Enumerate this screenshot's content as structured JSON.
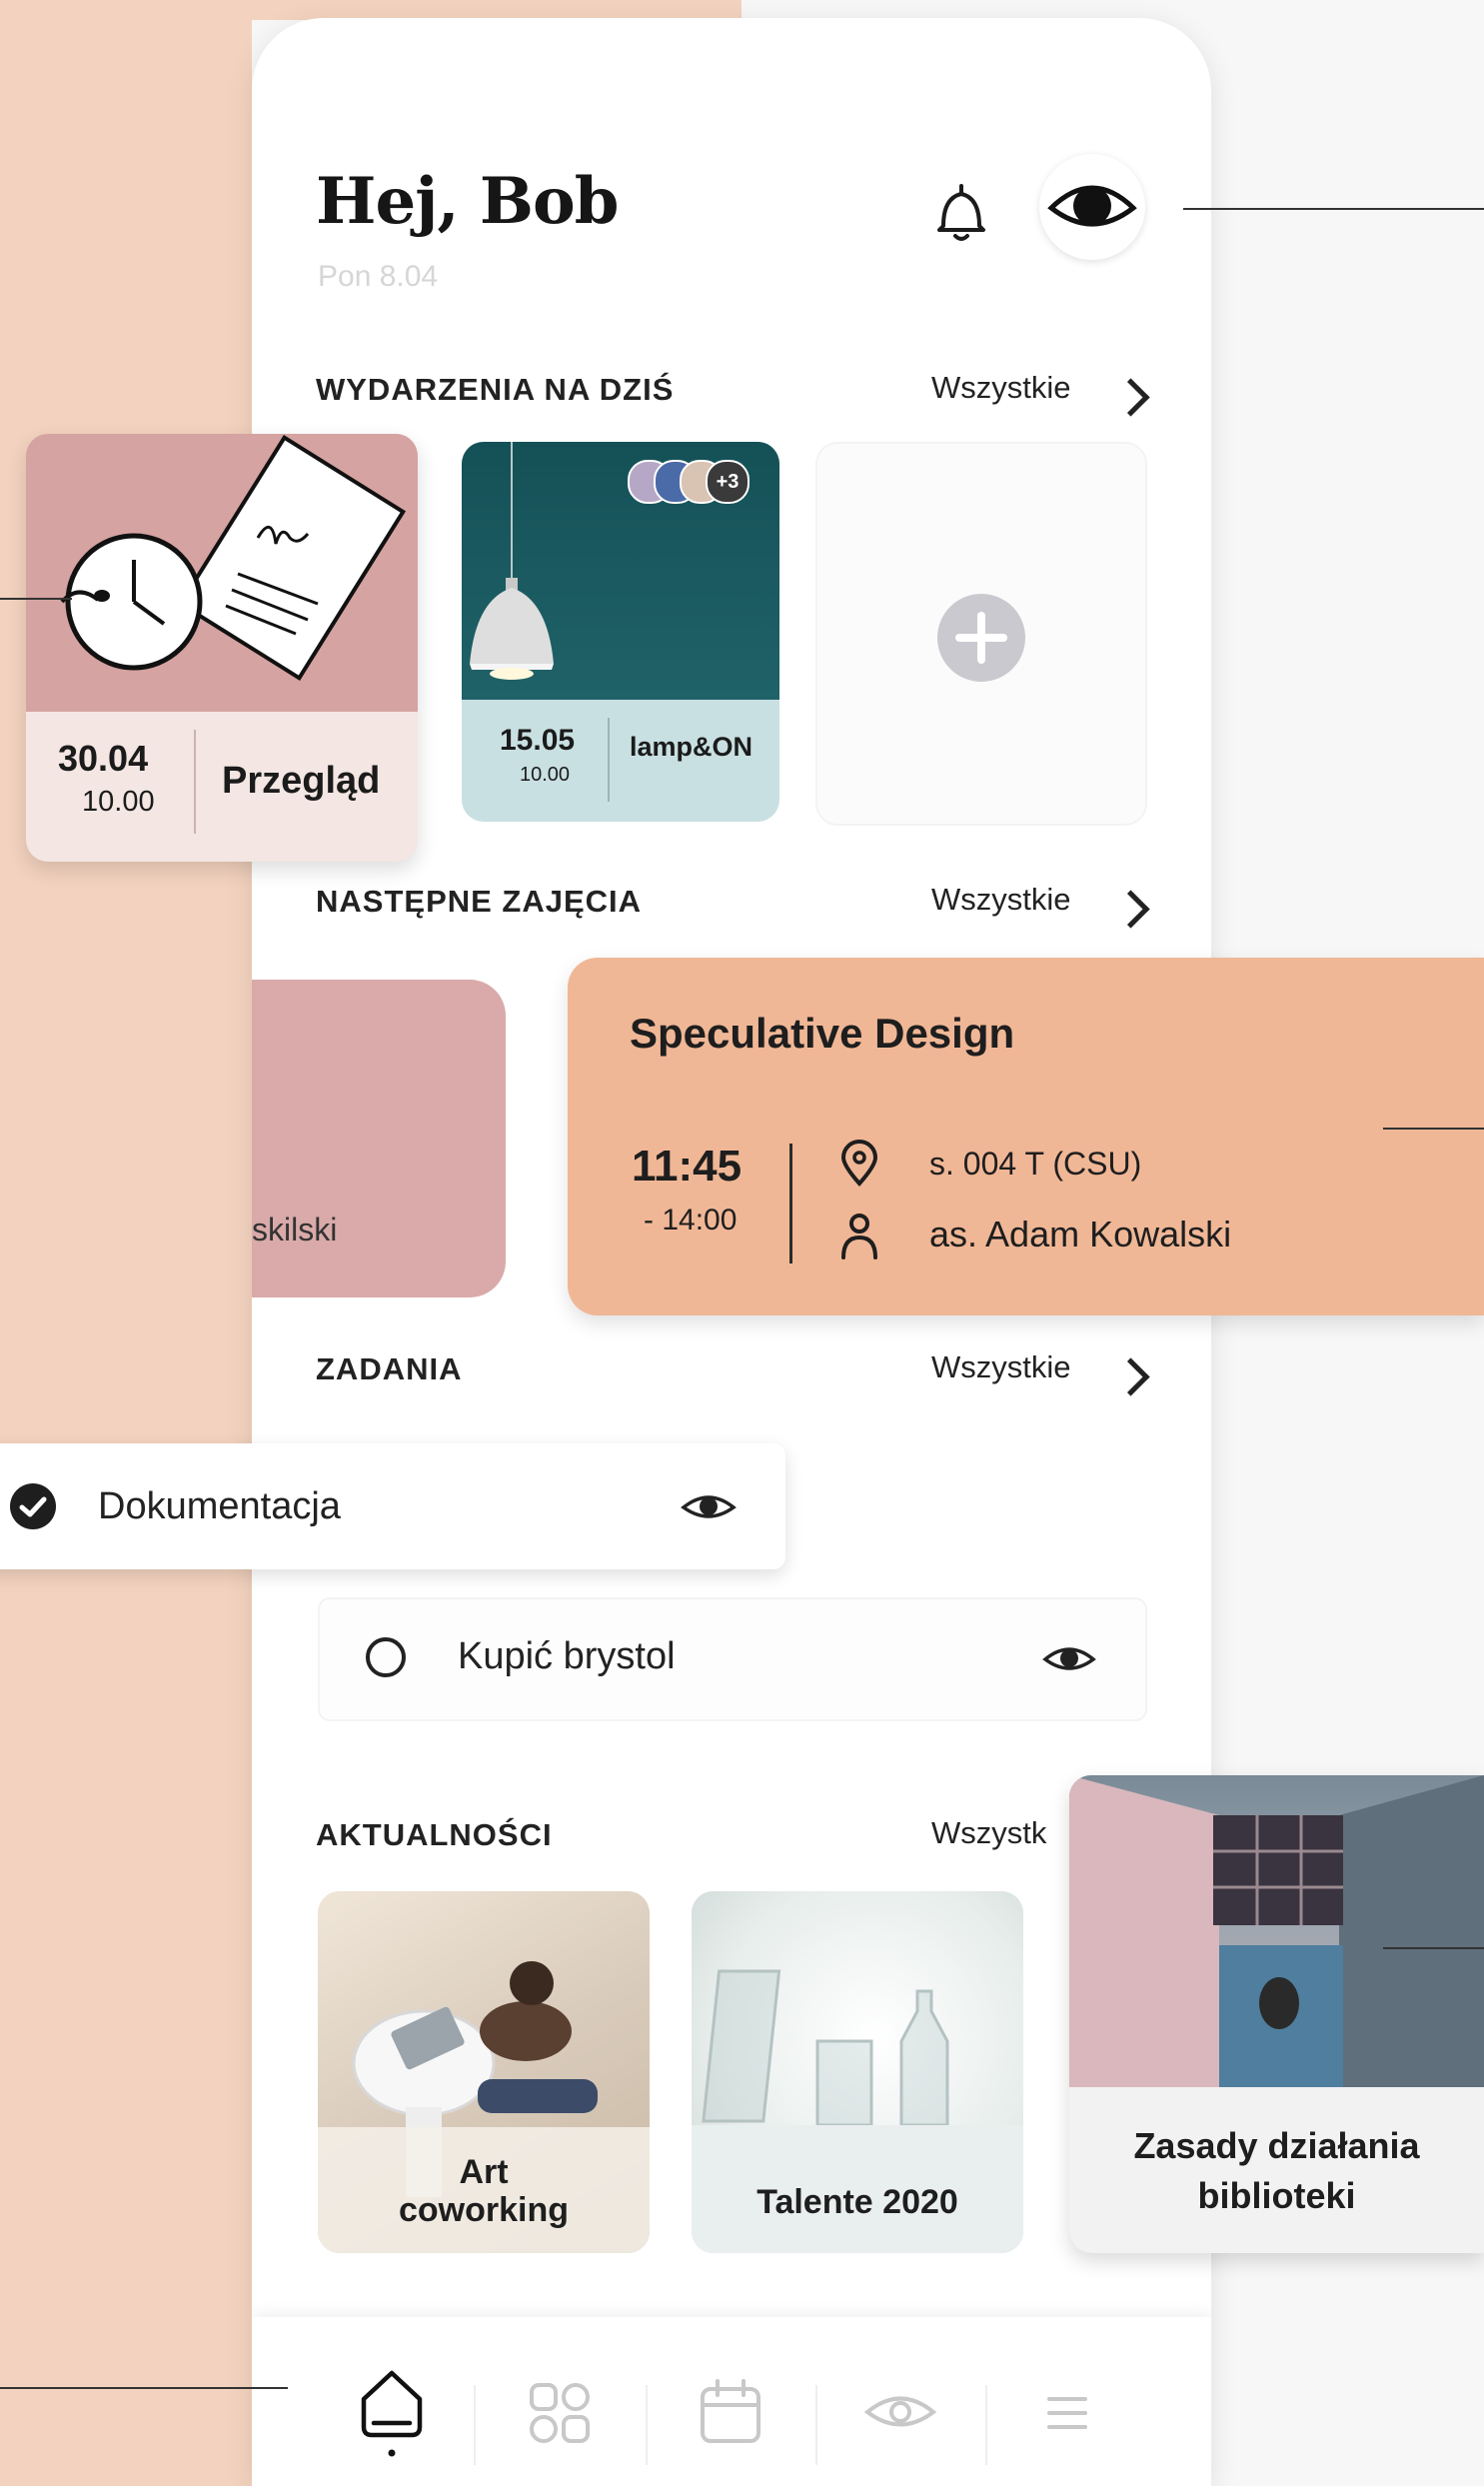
{
  "header": {
    "greeting": "Hej, Bob",
    "date": "Pon 8.04"
  },
  "events": {
    "title": "WYDARZENIA NA DZIŚ",
    "see_all": "Wszystkie",
    "items": [
      {
        "date": "30.04",
        "time": "10.00",
        "label": "Przegląd"
      },
      {
        "date": "15.05",
        "time": "10.00",
        "label": "lamp&ON",
        "attendees_more": "+3"
      }
    ]
  },
  "classes": {
    "title": "NASTĘPNE ZAJĘCIA",
    "see_all": "Wszystkie",
    "partial_card_text": "skilski",
    "featured": {
      "name": "Speculative Design",
      "time_start": "11:45",
      "time_end": "- 14:00",
      "room": "s. 004 T (CSU)",
      "teacher": "as. Adam Kowalski"
    }
  },
  "tasks": {
    "title": "ZADANIA",
    "see_all": "Wszystkie",
    "items": [
      {
        "label": "Dokumentacja",
        "done": true
      },
      {
        "label": "Kupić brystol",
        "done": false
      }
    ]
  },
  "news": {
    "title": "AKTUALNOŚCI",
    "see_all": "Wszystk",
    "items": [
      {
        "title_line1": "Art",
        "title_line2": "coworking"
      },
      {
        "title_line1": "Talente 2020",
        "title_line2": ""
      },
      {
        "title_line1": "Zasady działania",
        "title_line2": "biblioteki"
      }
    ]
  },
  "nav": {
    "items": [
      "home-icon",
      "grid-icon",
      "calendar-icon",
      "eye-icon",
      "menu-icon"
    ],
    "active": "home-icon"
  },
  "colors": {
    "peach_bg": "#f3d3bf",
    "rose_card": "#d8a6a4",
    "orange_card": "#f0b796",
    "teal": "#1f5e62"
  }
}
